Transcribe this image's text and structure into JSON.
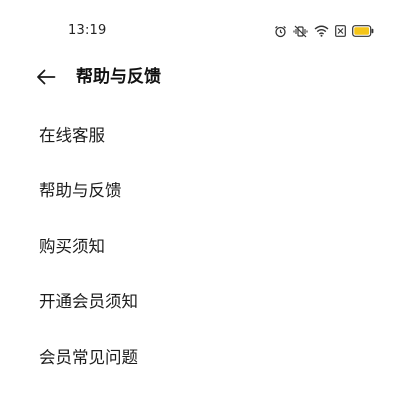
{
  "status_bar": {
    "time": "13:19",
    "icons": [
      "alarm-icon",
      "vibrate-mute-icon",
      "wifi-icon",
      "sim-icon",
      "battery-icon"
    ],
    "battery_color": "#f5c518"
  },
  "header": {
    "title": "帮助与反馈",
    "back_icon": "arrow-left-icon"
  },
  "menu": {
    "items": [
      {
        "label": "在线客服"
      },
      {
        "label": "帮助与反馈"
      },
      {
        "label": "购买须知"
      },
      {
        "label": "开通会员须知"
      },
      {
        "label": "会员常见问题"
      }
    ]
  }
}
